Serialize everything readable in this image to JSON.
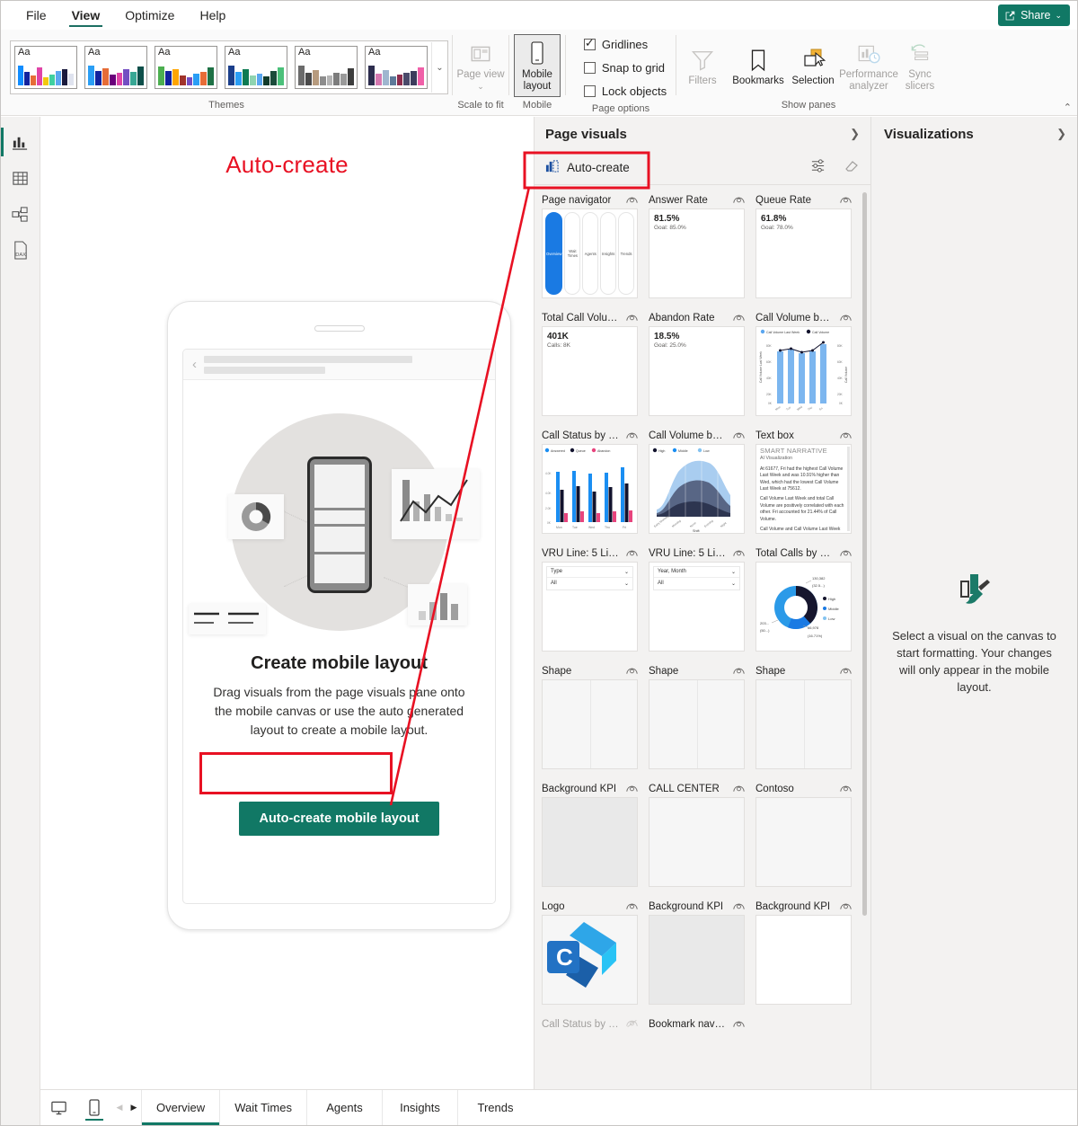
{
  "menu": {
    "items": [
      {
        "label": "File",
        "active": false
      },
      {
        "label": "View",
        "active": true
      },
      {
        "label": "Optimize",
        "active": false
      },
      {
        "label": "Help",
        "active": false
      }
    ],
    "share_label": "Share"
  },
  "ribbon": {
    "themes_group_label": "Themes",
    "theme_sample_text": "Aa",
    "scale_group_label": "Scale to fit",
    "page_view_label": "Page view",
    "mobile_group_label": "Mobile",
    "mobile_layout_label": "Mobile layout",
    "page_options_label": "Page options",
    "options": [
      {
        "label": "Gridlines",
        "checked": true
      },
      {
        "label": "Snap to grid",
        "checked": false
      },
      {
        "label": "Lock objects",
        "checked": false
      }
    ],
    "show_panes_label": "Show panes",
    "panes": [
      {
        "label": "Filters",
        "disabled": true
      },
      {
        "label": "Bookmarks",
        "disabled": false
      },
      {
        "label": "Selection",
        "disabled": false
      },
      {
        "label": "Performance analyzer",
        "disabled": true
      },
      {
        "label": "Sync slicers",
        "disabled": true
      }
    ]
  },
  "left_rail": {
    "items": [
      {
        "name": "report-view-icon",
        "active": true
      },
      {
        "name": "table-view-icon",
        "active": false
      },
      {
        "name": "model-view-icon",
        "active": false
      },
      {
        "name": "dax-query-view-icon",
        "active": false
      }
    ]
  },
  "canvas": {
    "annotation_title": "Auto-create",
    "empty_state": {
      "title": "Create mobile layout",
      "description": "Drag visuals from the page visuals pane onto the mobile canvas or use the auto generated layout to create a mobile layout.",
      "button_label": "Auto-create mobile layout"
    }
  },
  "page_visuals": {
    "title": "Page visuals",
    "auto_create_label": "Auto-create",
    "cards": [
      {
        "name": "Page navigator",
        "type": "navigator",
        "hidden": false,
        "pages": [
          "Overview",
          "Wait Times",
          "Agents",
          "Insights",
          "Trends"
        ],
        "selected_page": "Overview"
      },
      {
        "name": "Answer Rate",
        "type": "kpi",
        "hidden": false,
        "value": "81.5%",
        "goal": "Goal: 85.0%"
      },
      {
        "name": "Queue Rate",
        "type": "kpi",
        "hidden": false,
        "value": "61.8%",
        "goal": "Goal: 78.0%"
      },
      {
        "name": "Total Call Volume",
        "type": "kpi",
        "hidden": false,
        "value": "401K",
        "goal": "Calls: 8K"
      },
      {
        "name": "Abandon Rate",
        "type": "kpi",
        "hidden": false,
        "value": "18.5%",
        "goal": "Goal: 25.0%"
      },
      {
        "name": "Call Volume by ...",
        "type": "combo",
        "hidden": false,
        "legend": [
          "Call Volume Last Week",
          "Call Volume"
        ],
        "x_axis_label": "",
        "y_left_label": "Call Volume Last Week",
        "y_right_label": "Call Volume"
      },
      {
        "name": "Call Status by W...",
        "type": "clustered-bar",
        "hidden": false,
        "legend": [
          "Answered",
          "Queue",
          "Abandon"
        ]
      },
      {
        "name": "Call Volume by S...",
        "type": "stacked-area",
        "hidden": false,
        "legend": [
          "High",
          "Middle",
          "Low"
        ],
        "x_axis_label": "Shift"
      },
      {
        "name": "Text box",
        "type": "narrative",
        "hidden": false
      },
      {
        "name": "VRU Line: 5 Line...",
        "type": "slicer",
        "hidden": false,
        "slicer_label": "Type",
        "slicer_value": "All"
      },
      {
        "name": "VRU Line: 5 Line...",
        "type": "slicer",
        "hidden": false,
        "slicer_label": "Year, Month",
        "slicer_value": "All"
      },
      {
        "name": "Total Calls by Pri...",
        "type": "donut",
        "hidden": false,
        "legend": [
          "High",
          "Middle",
          "Low"
        ]
      },
      {
        "name": "Shape",
        "type": "shape",
        "hidden": false
      },
      {
        "name": "Shape",
        "type": "shape",
        "hidden": false
      },
      {
        "name": "Shape",
        "type": "shape",
        "hidden": false
      },
      {
        "name": "Background KPI",
        "type": "blank-grey",
        "hidden": false
      },
      {
        "name": "CALL CENTER",
        "type": "blank",
        "hidden": false
      },
      {
        "name": "Contoso",
        "type": "blank",
        "hidden": false
      },
      {
        "name": "Logo",
        "type": "logo",
        "hidden": false
      },
      {
        "name": "Background KPI",
        "type": "blank-grey",
        "hidden": false
      },
      {
        "name": "Background KPI",
        "type": "blank-white",
        "hidden": false
      }
    ],
    "partial_cards": [
      {
        "name": "Call Status by M...",
        "hidden": true
      },
      {
        "name": "Bookmark navig...",
        "hidden": false
      }
    ],
    "narrative": {
      "title": "SMART NARRATIVE",
      "subtitle": "AI Visualization",
      "paragraphs": [
        "At 61677, Fri had the highest Call Volume Last Week and was 10.91% higher than Wed, which had the lowest Call Volume Last Week at 75612.",
        "Call Volume Last Week and total Call Volume are positively correlated with each other. Fri accounted for 21.44% of Call Volume.",
        "Call Volume and Call Volume Last Week"
      ]
    },
    "donut_labels": {
      "top": "130,382",
      "top_sub": "(32.5...)",
      "left": "203...",
      "left_sub": "(50...)",
      "bottom": "66,978",
      "bottom_sub": "(16.71%)"
    },
    "bar_axis_categories": [
      "Mon",
      "Tue",
      "Wed",
      "Thu",
      "Fri"
    ],
    "area_axis_categories": [
      "Early Morning",
      "Morning",
      "Noon",
      "Evening",
      "Night"
    ],
    "combo_axis_categories": [
      "Mon",
      "Tue",
      "Wed",
      "Thu",
      "Fri"
    ],
    "combo_y_ticks": [
      "0K",
      "20K",
      "40K",
      "60K",
      "80K"
    ],
    "logo_letter": "C"
  },
  "visualizations": {
    "title": "Visualizations",
    "empty_message": "Select a visual on the canvas to start formatting. Your changes will only appear in the mobile layout."
  },
  "bottom_bar": {
    "tabs": [
      {
        "label": "Overview",
        "active": true
      },
      {
        "label": "Wait Times",
        "active": false
      },
      {
        "label": "Agents",
        "active": false
      },
      {
        "label": "Insights",
        "active": false
      },
      {
        "label": "Trends",
        "active": false
      }
    ]
  },
  "chart_data": [
    {
      "type": "bar",
      "title": "Call Volume by ...",
      "categories": [
        "Mon",
        "Tue",
        "Wed",
        "Thu",
        "Fri"
      ],
      "series": [
        {
          "name": "Call Volume Last Week",
          "values": [
            60,
            62,
            58,
            60,
            70
          ]
        },
        {
          "name": "Call Volume",
          "values": [
            62,
            64,
            60,
            62,
            72
          ]
        }
      ],
      "ylabel": "Call Volume Last Week",
      "y2label": "Call Volume",
      "ylim": [
        0,
        80
      ]
    },
    {
      "type": "bar",
      "title": "Call Status by W...",
      "categories": [
        "Mon",
        "Tue",
        "Wed",
        "Thu",
        "Fri"
      ],
      "series": [
        {
          "name": "Answered",
          "values": [
            4.3,
            4.35,
            4.2,
            4.25,
            4.6
          ]
        },
        {
          "name": "Queue",
          "values": [
            2.6,
            2.9,
            2.5,
            2.85,
            3.1
          ]
        },
        {
          "name": "Abandon",
          "values": [
            0.6,
            0.7,
            0.6,
            0.7,
            0.75
          ]
        }
      ],
      "ylim": [
        0,
        5
      ]
    },
    {
      "type": "area",
      "title": "Call Volume by S...",
      "categories": [
        "Early Morning",
        "Morning",
        "Noon",
        "Evening",
        "Night"
      ],
      "xlabel": "Shift",
      "series": [
        {
          "name": "High",
          "values": [
            5,
            22,
            46,
            42,
            14
          ]
        },
        {
          "name": "Middle",
          "values": [
            8,
            30,
            58,
            52,
            20
          ]
        },
        {
          "name": "Low",
          "values": [
            12,
            48,
            86,
            80,
            34
          ]
        }
      ]
    },
    {
      "type": "pie",
      "title": "Total Calls by Pri...",
      "labels": [
        "High",
        "Middle",
        "Low"
      ],
      "values": [
        130382,
        203000,
        66978
      ],
      "percents": [
        32.5,
        50.0,
        16.71
      ]
    }
  ]
}
